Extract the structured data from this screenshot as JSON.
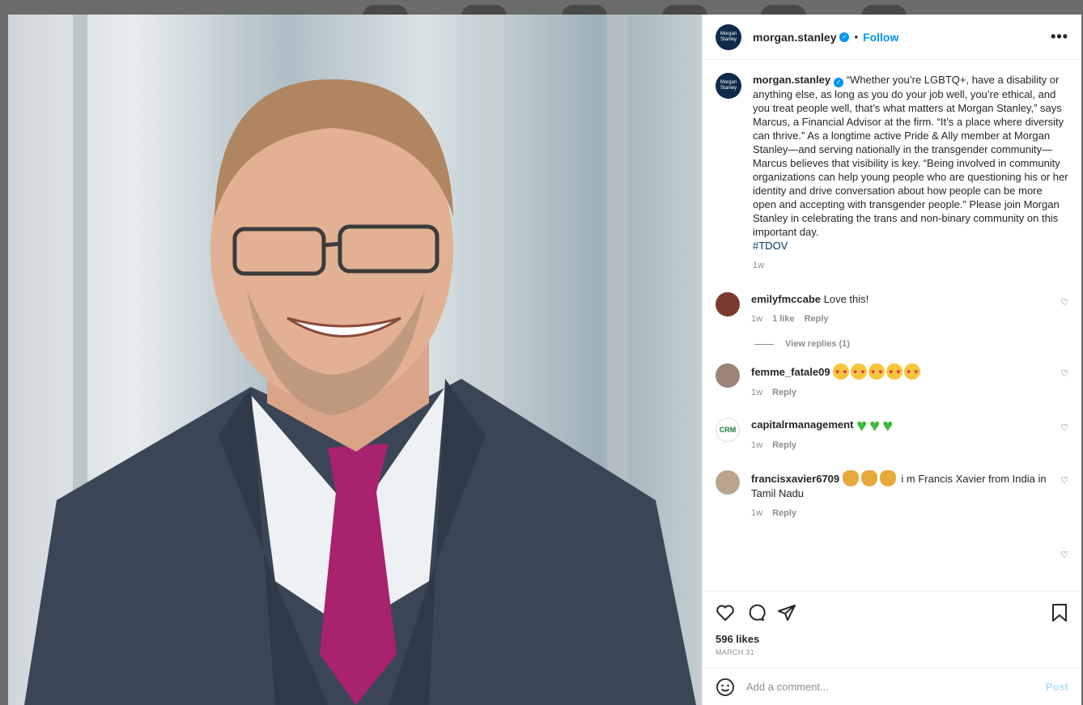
{
  "post": {
    "username": "morgan.stanley",
    "avatar_text": "Morgan Stanley",
    "follow_label": "Follow",
    "more_label": "•••",
    "caption": "“Whether you’re LGBTQ+, have a disability or anything else, as long as you do your job well, you’re ethical, and you treat people well, that’s what matters at Morgan Stanley,” says Marcus, a Financial Advisor at the firm. “It’s a place where diversity can thrive.” As a longtime active Pride & Ally member at Morgan Stanley—and serving nationally in the transgender community—Marcus believes that visibility is key. “Being involved in community organizations can help young people who are questioning his or her identity and drive conversation about how people can be more open and accepting with transgender people.” Please join Morgan Stanley in celebrating the trans and non-binary community on this important day.",
    "hashtag": "#TDOV",
    "caption_time": "1w",
    "likes": "596 likes",
    "date": "MARCH 31"
  },
  "comments": [
    {
      "user": "emilyfmccabe",
      "text": "Love this!",
      "time": "1w",
      "likes": "1 like",
      "reply": "Reply",
      "avatar_color": "#7a3b2e",
      "view_replies": "View replies (1)"
    },
    {
      "user": "femme_fatale09",
      "text": "",
      "time": "1w",
      "reply": "Reply",
      "avatar_color": "#9a8478"
    },
    {
      "user": "capitalrmanagement",
      "text": "",
      "time": "1w",
      "reply": "Reply",
      "avatar_color": "#ffffff",
      "avatar_text": "CRM"
    },
    {
      "user": "francisxavier6709",
      "text": "i m Francis Xavier from India in Tamil Nadu",
      "time": "1w",
      "reply": "Reply",
      "avatar_color": "#b9a48e"
    }
  ],
  "add_comment": {
    "placeholder": "Add a comment...",
    "post_label": "Post"
  },
  "colors": {
    "accent": "#0095f6",
    "post_disabled": "#b2dffc",
    "hashtag": "#00376b"
  }
}
